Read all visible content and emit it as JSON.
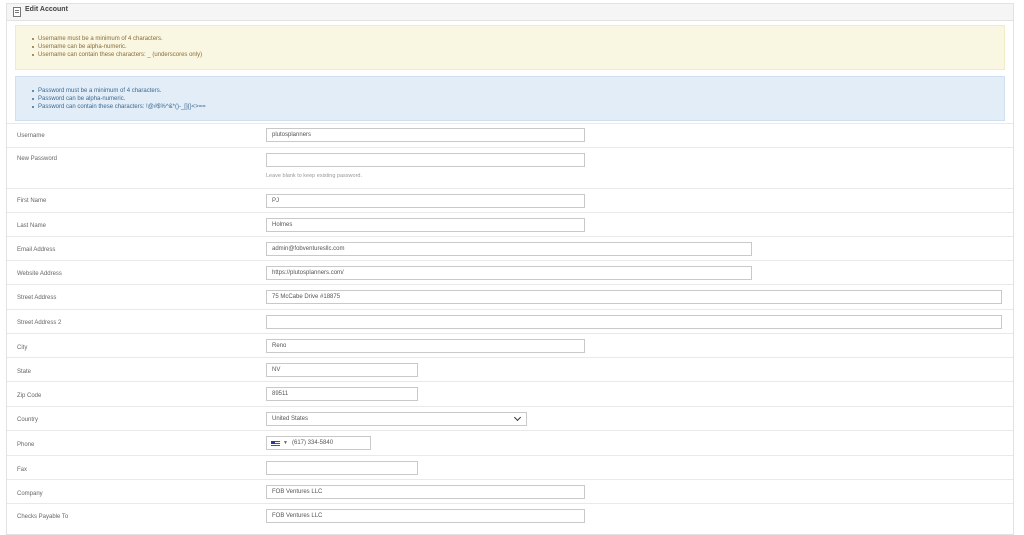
{
  "header": {
    "title": "Edit Account",
    "icon": "document-icon"
  },
  "username_rules": [
    "Username must be a minimum of 4 characters.",
    "Username can be alpha-numeric.",
    "Username can contain these characters: _ (underscores only)"
  ],
  "password_rules": [
    "Password must be a minimum of 4 characters.",
    "Password can be alpha-numeric.",
    "Password can contain these characters: !@#$%^&*()-_[]{}<>=="
  ],
  "form": {
    "username": {
      "label": "Username",
      "value": "plutosplanners"
    },
    "new_password": {
      "label": "New Password",
      "value": "",
      "help": "Leave blank to keep existing password."
    },
    "first_name": {
      "label": "First Name",
      "value": "PJ"
    },
    "last_name": {
      "label": "Last Name",
      "value": "Holmes"
    },
    "email": {
      "label": "Email Address",
      "value": "admin@fobventuresllc.com"
    },
    "website": {
      "label": "Website Address",
      "value": "https://plutosplanners.com/"
    },
    "street": {
      "label": "Street Address",
      "value": "75 McCabe Drive #18875"
    },
    "street2": {
      "label": "Street Address 2",
      "value": ""
    },
    "city": {
      "label": "City",
      "value": "Reno"
    },
    "state": {
      "label": "State",
      "value": "NV"
    },
    "zip": {
      "label": "Zip Code",
      "value": "89511"
    },
    "country": {
      "label": "Country",
      "value": "United States"
    },
    "phone": {
      "label": "Phone",
      "value": "(617) 334-5840",
      "flag": "us-flag-icon"
    },
    "fax": {
      "label": "Fax",
      "value": ""
    },
    "company": {
      "label": "Company",
      "value": "FOB Ventures LLC"
    },
    "checks_payable": {
      "label": "Checks Payable To",
      "value": "FOB Ventures LLC"
    }
  }
}
